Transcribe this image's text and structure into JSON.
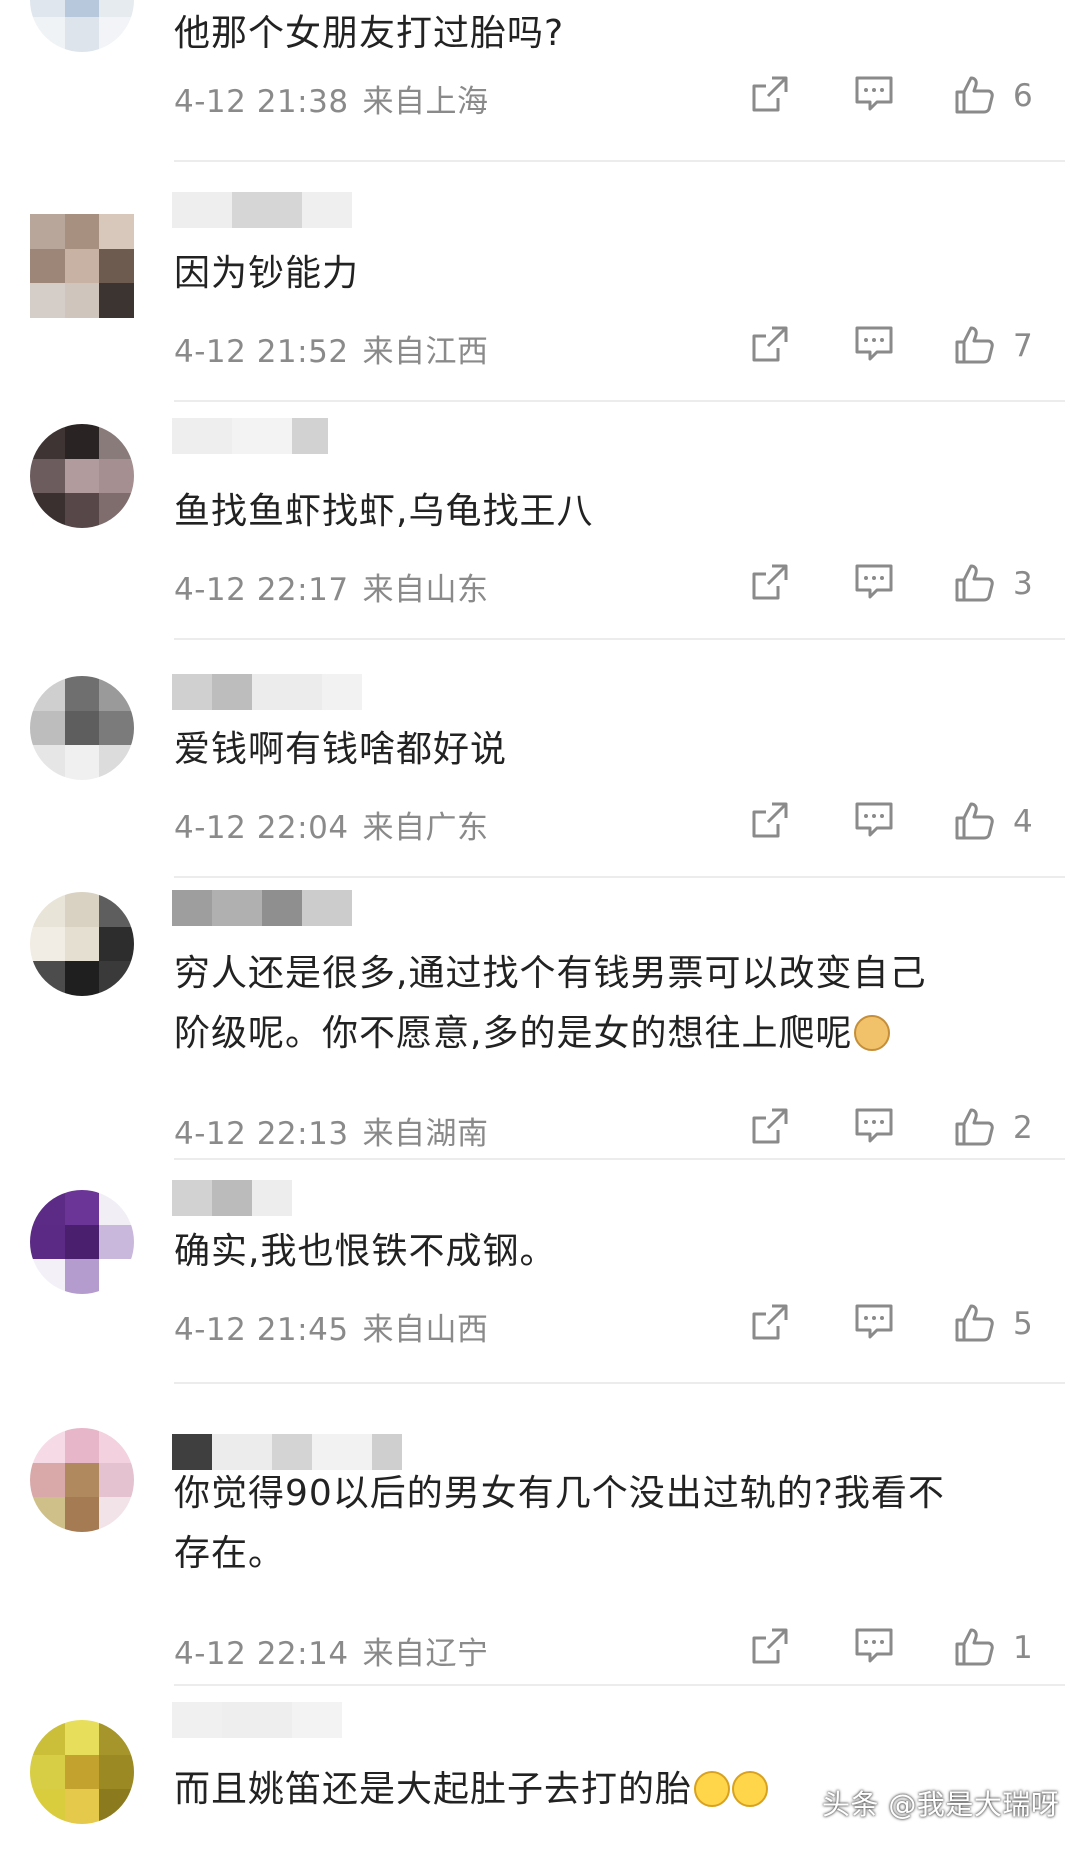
{
  "comments": [
    {
      "text": "他那个女朋友打过胎吗?",
      "time": "4-12 21:38",
      "location": "来自上海",
      "likes": "6"
    },
    {
      "text": "因为钞能力",
      "time": "4-12 21:52",
      "location": "来自江西",
      "likes": "7"
    },
    {
      "text": "鱼找鱼虾找虾,乌龟找王八",
      "time": "4-12 22:17",
      "location": "来自山东",
      "likes": "3"
    },
    {
      "text": "爱钱啊有钱啥都好说",
      "time": "4-12 22:04",
      "location": "来自广东",
      "likes": "4"
    },
    {
      "text_line1": "穷人还是很多,通过找个有钱男票可以改变自己",
      "text_line2": "阶级呢。你不愿意,多的是女的想往上爬呢",
      "time": "4-12 22:13",
      "location": "来自湖南",
      "likes": "2"
    },
    {
      "text": "确实,我也恨铁不成钢。",
      "time": "4-12 21:45",
      "location": "来自山西",
      "likes": "5"
    },
    {
      "text_line1": "你觉得90以后的男女有几个没出过轨的?我看不",
      "text_line2": "存在。",
      "time": "4-12 22:14",
      "location": "来自辽宁",
      "likes": "1"
    },
    {
      "text": "而且姚笛还是大起肚子去打的胎"
    }
  ],
  "icons": {
    "share": "share-icon",
    "reply": "reply-icon",
    "like": "thumbs-up-icon",
    "emoji_doge": "doge-emoji-icon",
    "emoji_cry": "crying-emoji-icon"
  },
  "watermark": "头条 @我是大瑞呀",
  "colors": {
    "text": "#222222",
    "meta": "#8a8a8a",
    "divider": "#ececec"
  }
}
